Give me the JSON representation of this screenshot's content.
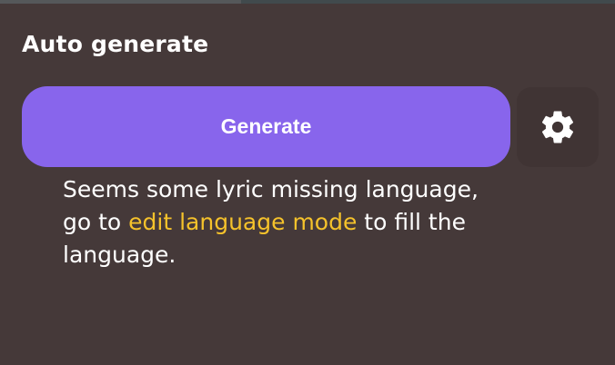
{
  "panel": {
    "title": "Auto generate",
    "generate_label": "Generate",
    "settings_icon": "gear-icon",
    "message": {
      "part1": "Seems some lyric missing language,",
      "part2": "go to ",
      "link_text": "edit language mode",
      "part3": " to fill the",
      "part4": "language."
    }
  },
  "colors": {
    "background": "#453939",
    "button": "#8865ec",
    "link": "#f5c22b",
    "text": "#ffffff"
  }
}
